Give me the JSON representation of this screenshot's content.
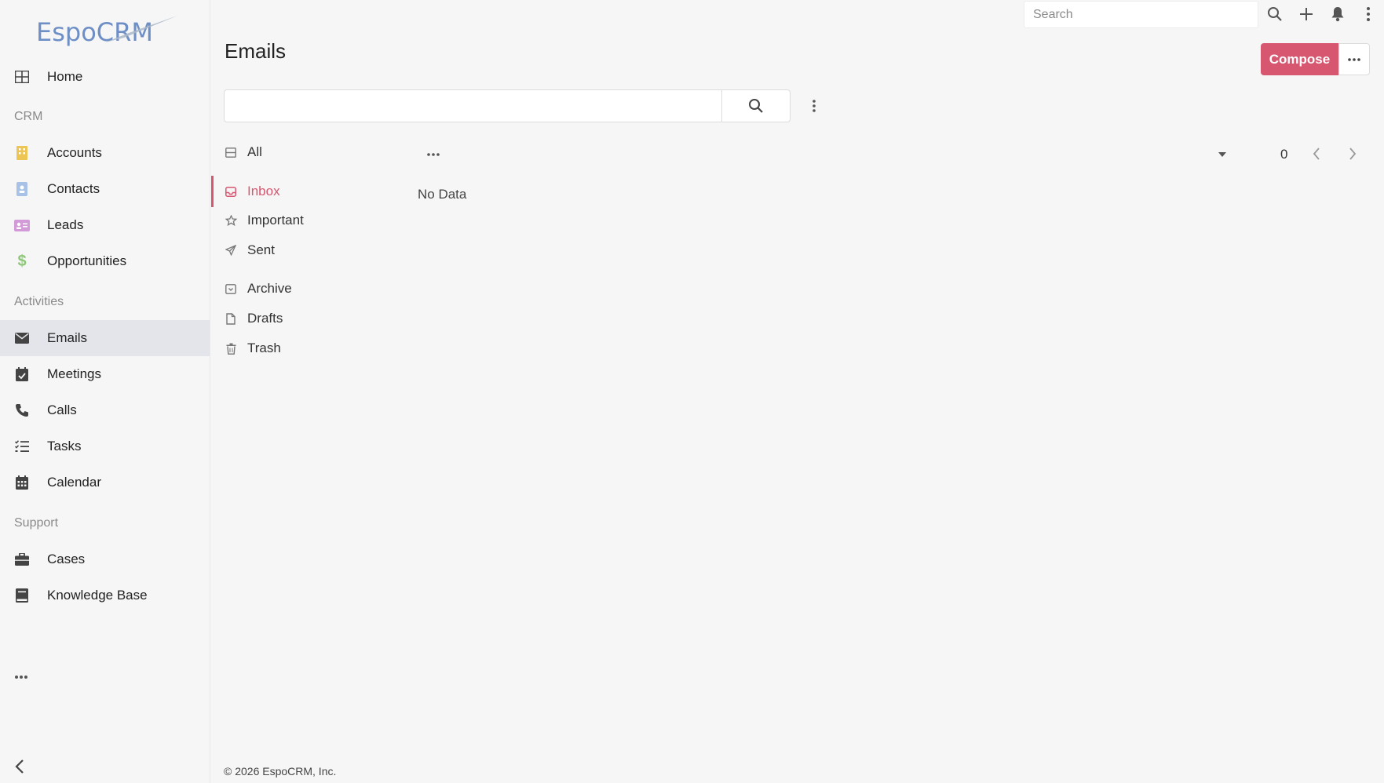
{
  "app": {
    "logo_text": "EspoCRM"
  },
  "topbar": {
    "search_placeholder": "Search",
    "icons": [
      "search-icon",
      "plus-icon",
      "bell-icon",
      "kebab-menu-icon"
    ]
  },
  "sidebar": {
    "home": "Home",
    "sections": {
      "crm": "CRM",
      "activities": "Activities",
      "support": "Support"
    },
    "items": {
      "accounts": "Accounts",
      "contacts": "Contacts",
      "leads": "Leads",
      "opportunities": "Opportunities",
      "emails": "Emails",
      "meetings": "Meetings",
      "calls": "Calls",
      "tasks": "Tasks",
      "calendar": "Calendar",
      "cases": "Cases",
      "knowledge_base": "Knowledge Base"
    },
    "active": "emails",
    "colors": {
      "accounts": "#edc555",
      "contacts": "#a8c1e6",
      "leads": "#d29ad7",
      "opportunities": "#8fc77a"
    }
  },
  "header": {
    "title": "Emails",
    "compose_label": "Compose"
  },
  "filter": {
    "value": ""
  },
  "folders": {
    "all": "All",
    "inbox": "Inbox",
    "important": "Important",
    "sent": "Sent",
    "archive": "Archive",
    "drafts": "Drafts",
    "trash": "Trash",
    "active": "inbox"
  },
  "list": {
    "empty_text": "No Data",
    "total_count": "0"
  },
  "footer": {
    "text": "© 2026 EspoCRM, Inc."
  },
  "theme": {
    "accent": "#d75670",
    "active_nav_bg": "#e3e5ea"
  }
}
